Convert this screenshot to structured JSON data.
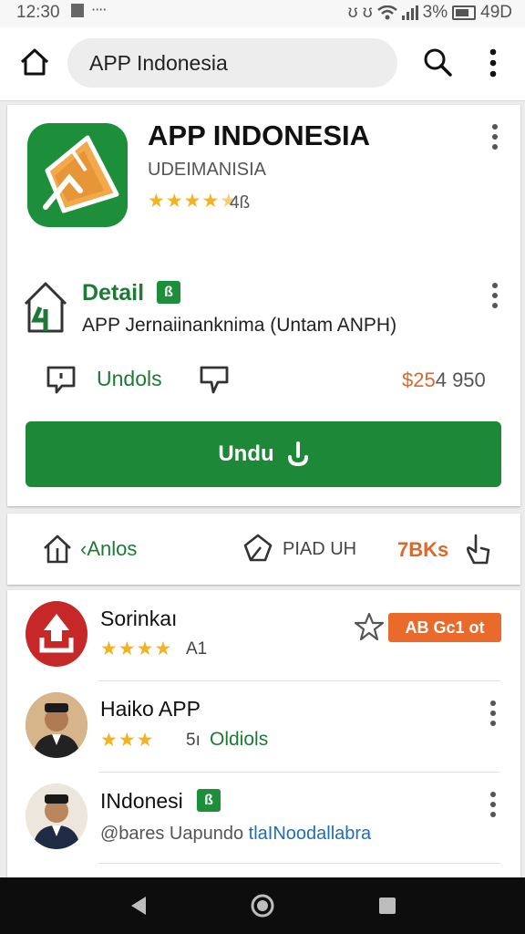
{
  "status_bar": {
    "time": "12:30",
    "dots": "⋅⋅⋅⋅",
    "right_icons": "ʊ ʊ",
    "battery_pct": "3%",
    "right_text": "49D"
  },
  "top_bar": {
    "search_query": "APP Indonesia"
  },
  "app": {
    "title": "APP INDONESIA",
    "developer": "UDEIMANISIA",
    "stars": "★★★★",
    "half_star": "★",
    "rating": "4ß",
    "icon_colors": {
      "background": "#1d8f3a",
      "ticket": "#f3a84a"
    }
  },
  "detail": {
    "label": "Detail",
    "badge": "ß",
    "subtitle": "APP Jernaiinanknima (Untam ANPH)",
    "undo_label": "Undols",
    "price_prefix": "$25",
    "price_rest": "4 950",
    "install_label": "Undu"
  },
  "stats": {
    "label_1": "‹Anlos",
    "label_2": "PIAD UH",
    "label_3": "7BKs"
  },
  "list": [
    {
      "title": "Sorinkaı",
      "stars": "★★★★",
      "rating": "A1",
      "chip": "AB Gc1 ot"
    },
    {
      "title": "Haiko APP",
      "stars": "★★★",
      "rating": "5ı",
      "extra": "Oldiols"
    },
    {
      "title": "INdonesi",
      "badge": "ß",
      "sub_prefix": "@bares Uapundo",
      "sub_link": "tlaINoodallabra"
    }
  ],
  "colors": {
    "accent_green": "#1d8938",
    "star": "#f1b323",
    "orange": "#e96a2a",
    "logo_red": "#c62828"
  }
}
